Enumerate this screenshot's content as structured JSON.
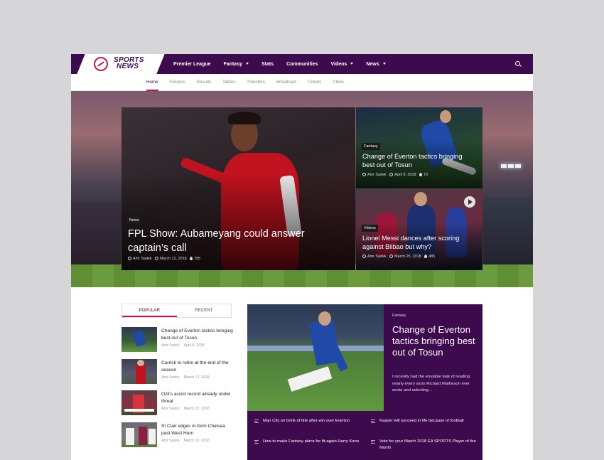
{
  "logo": {
    "text_line1": "SPORTS",
    "text_line2": "NEWS"
  },
  "nav": {
    "items": [
      {
        "label": "Premier League",
        "dropdown": false
      },
      {
        "label": "Fantasy",
        "dropdown": true
      },
      {
        "label": "Stats",
        "dropdown": false
      },
      {
        "label": "Communities",
        "dropdown": false
      },
      {
        "label": "Videos",
        "dropdown": true
      },
      {
        "label": "News",
        "dropdown": true
      }
    ]
  },
  "subnav": {
    "items": [
      "Home",
      "Fixtures",
      "Results",
      "Tables",
      "Transfers",
      "Broadcast",
      "Tickets",
      "Clubs"
    ],
    "active": "Home"
  },
  "hero": {
    "main": {
      "tag": "News",
      "title": "FPL Show: Aubameyang could answer captain’s call",
      "author": "Amr Sadek",
      "date": "March 12, 2018",
      "views": "705"
    },
    "side1": {
      "tag": "Fantasy",
      "title": "Change of Everton tactics bringing best out of Tosun",
      "author": "Amr Sadek",
      "date": "April 8, 2018",
      "views": "73"
    },
    "side2": {
      "tag": "Videos",
      "title": "Lionel Messi dances after scoring against Bilbao but why?",
      "author": "Amr Sadek",
      "date": "March 25, 2018",
      "views": "485"
    }
  },
  "tabs": {
    "popular": "POPULAR",
    "recent": "RECENT"
  },
  "list": [
    {
      "title": "Change of Everton tactics bringing best out of Tosun",
      "author": "Amr Sadek",
      "date": "April 8, 2018"
    },
    {
      "title": "Carrick to retire at the end of the season",
      "author": "Amr Sadek",
      "date": "March 12, 2018"
    },
    {
      "title": "Ozil’s assist record already under threat",
      "author": "Amr Sadek",
      "date": "March 12, 2018"
    },
    {
      "title": "St Clair edges in-form Chelsea past West Ham",
      "author": "Amr Sadek",
      "date": "March 12, 2018"
    }
  ],
  "feature": {
    "category": "Fantasy",
    "title": "Change of Everton tactics bringing best out of Tosun",
    "description": "I recently had the enviable task of reading nearly every story Richard Matheson ever wrote and selecting...",
    "links": [
      "Man City on brink of title after win over Everton",
      "Kasper will succeed in life because of football",
      "How to make Fantasy plans for fit-again Harry Kane",
      "Vote for your March 2018 EA SPORTS Player of the Month"
    ]
  },
  "colors": {
    "brand": "#3d0a4d",
    "accent": "#c6174e"
  }
}
